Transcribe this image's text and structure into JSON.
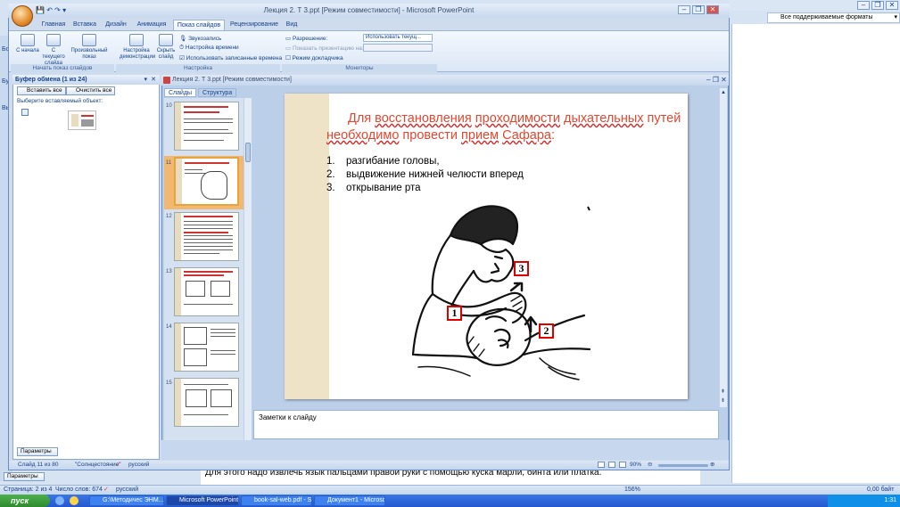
{
  "word": {
    "formats_label": "Все поддерживаемые форматы",
    "doc_text": "Для этого надо извлечь язык пальцами правой руки с помощью куска марли, бинта или платка.",
    "params_label": "Параметры",
    "status_page": "Страница: 2 из 4",
    "status_words": "Число слов: 674",
    "status_lang": "русский",
    "status_zoom": "156%",
    "status_right": "0,00 байт",
    "left_labels": [
      "Бо",
      "Буф",
      "Выб"
    ]
  },
  "ppt": {
    "window_title": "Лекция 2. Т 3.ppt [Режим совместимости] - Microsoft PowerPoint",
    "tabs": [
      "Главная",
      "Вставка",
      "Дизайн",
      "Анимация",
      "Показ слайдов",
      "Рецензирование",
      "Вид"
    ],
    "active_tab": "Показ слайдов",
    "ribbon": {
      "btn_from_start": "С начала",
      "btn_from_current": "С текущего слайда",
      "btn_custom": "Произвольный показ",
      "group_start": "Начать показ слайдов",
      "btn_setup": "Настройка демонстрации",
      "btn_hide": "Скрыть слайд",
      "rec_sound": "Звукозапись",
      "rehearse": "Настройка времени",
      "use_timings": "Использовать записанные времена",
      "group_setup": "Настройка",
      "resolution_label": "Разрешение:",
      "resolution_value": "Использовать текущ...",
      "show_on_label": "Показать презентацию на:",
      "presenter_view": "Режим докладчика",
      "group_monitors": "Мониторы"
    },
    "clipboard": {
      "title": "Буфер обмена (1 из 24)",
      "paste_all": "Вставить все",
      "clear_all": "Очистить все",
      "hint": "Выберите вставляемый объект:",
      "params": "Параметры"
    },
    "inner_title": "Лекция 2. Т 3.ppt [Режим совместимости]",
    "pane_tabs": [
      "Слайды",
      "Структура"
    ],
    "thumb_numbers": [
      "10",
      "11",
      "12",
      "13",
      "14",
      "15"
    ],
    "slide": {
      "title_parts": [
        "Для ",
        "восстановления",
        " ",
        "проходимости",
        " ",
        "дыхательных",
        " путей ",
        "необходимо",
        " провести ",
        "прием",
        " ",
        "Сафара",
        ":"
      ],
      "items": [
        {
          "n": "1.",
          "text": "разгибание головы,"
        },
        {
          "n": "2.",
          "text": "выдвижение нижней челюсти вперед"
        },
        {
          "n": "3.",
          "text": "открывание рта"
        }
      ],
      "labels": [
        "1",
        "2",
        "3"
      ]
    },
    "notes_placeholder": "Заметки к слайду",
    "status": {
      "slide_of": "Слайд 11 из 80",
      "theme": "\"Солнцестояние\"",
      "lang": "русский",
      "zoom": "90%"
    }
  },
  "taskbar": {
    "start": "пуск",
    "items": [
      "G:\\Методичес ЭНМ...",
      "Microsoft PowerPoint",
      "book-sal-web.pdf - S...",
      "Документ1 - Microso..."
    ],
    "active_index": 1,
    "clock": "1:31"
  }
}
